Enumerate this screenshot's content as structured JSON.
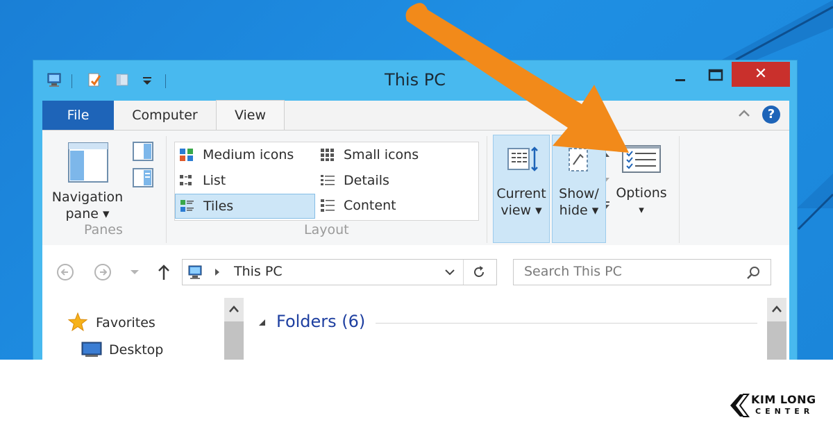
{
  "window": {
    "title": "This PC",
    "close_label": "✕"
  },
  "tabs": [
    {
      "label": "File"
    },
    {
      "label": "Computer"
    },
    {
      "label": "View"
    }
  ],
  "ribbon": {
    "panes": {
      "navigation_pane_line1": "Navigation",
      "navigation_pane_line2": "pane ▾",
      "group_label": "Panes"
    },
    "layout": {
      "items": [
        {
          "label": "Medium icons"
        },
        {
          "label": "Small icons"
        },
        {
          "label": "List"
        },
        {
          "label": "Details"
        },
        {
          "label": "Tiles"
        },
        {
          "label": "Content"
        }
      ],
      "selected": "Tiles",
      "group_label": "Layout"
    },
    "current_view": {
      "line1": "Current",
      "line2": "view ▾"
    },
    "show_hide": {
      "line1": "Show/",
      "line2": "hide ▾"
    },
    "options": {
      "label": "Options",
      "arrow": "▾"
    }
  },
  "navbar": {
    "address": "This PC",
    "search_placeholder": "Search This PC"
  },
  "nav_pane": {
    "favorites": "Favorites",
    "desktop": "Desktop"
  },
  "content": {
    "folders_header": "Folders (6)"
  },
  "brand": {
    "line1": "KIM LONG",
    "line2": "CENTER"
  },
  "colors": {
    "desktop_bg": "#1b86da",
    "window_frame": "#48b9ef",
    "file_tab": "#1e64b8",
    "close_button": "#c9302c",
    "arrow": "#f28a1a"
  }
}
